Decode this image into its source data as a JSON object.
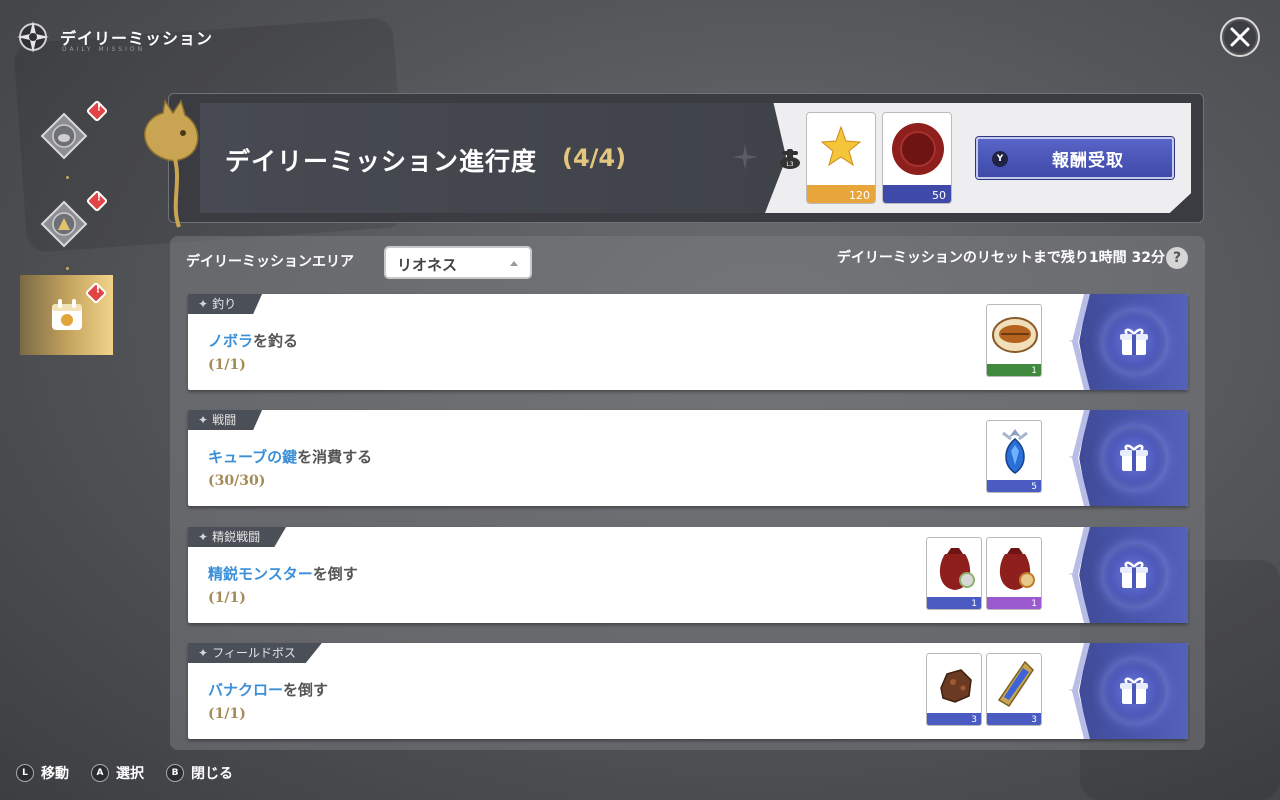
{
  "header": {
    "title": "デイリーミッション",
    "subtitle": "DAILY MISSION"
  },
  "sidebar": {
    "items": [
      {
        "icon": "boar-medal-icon",
        "badge": "!"
      },
      {
        "icon": "compass-medal-icon",
        "badge": "!"
      },
      {
        "icon": "calendar-gift-icon",
        "badge": "!",
        "active": true
      }
    ]
  },
  "banner": {
    "title": "デイリーミッション進行度",
    "count": "(4/4)",
    "rewards": [
      {
        "icon": "star-moon-crystal-icon",
        "count": "120",
        "color": "#e8a53a"
      },
      {
        "icon": "wax-seal-icon",
        "count": "50",
        "color": "#3f4aa8"
      }
    ],
    "claim_key": "Y",
    "claim_label": "報酬受取"
  },
  "area": {
    "label": "デイリーミッションエリア",
    "selected": "リオネス",
    "reset_text": "デイリーミッションのリセットまで残り1時間 32分",
    "help": "?"
  },
  "missions": [
    {
      "category": "釣り",
      "highlight": "ノボラ",
      "suffix": "を釣る",
      "progress": "(1/1)",
      "items": [
        {
          "icon": "grilled-fish-icon",
          "count": "1",
          "color": "#3f8a3c"
        }
      ]
    },
    {
      "category": "戦闘",
      "highlight": "キューブの鍵",
      "suffix": "を消費する",
      "progress": "(30/30)",
      "items": [
        {
          "icon": "blue-crystal-key-icon",
          "count": "5",
          "color": "#4a5bc2"
        }
      ]
    },
    {
      "category": "精鋭戦闘",
      "highlight": "精鋭モンスター",
      "suffix": "を倒す",
      "progress": "(1/1)",
      "items": [
        {
          "icon": "red-pouch-icon",
          "count": "1",
          "color": "#4a5bc2"
        },
        {
          "icon": "red-pouch-icon",
          "count": "1",
          "color": "#9b59d0"
        }
      ]
    },
    {
      "category": "フィールドボス",
      "highlight": "バナクロー",
      "suffix": "を倒す",
      "progress": "(1/1)",
      "items": [
        {
          "icon": "ore-chunk-icon",
          "count": "3",
          "color": "#4a5bc2"
        },
        {
          "icon": "blue-gem-shard-icon",
          "count": "3",
          "color": "#4a5bc2"
        }
      ]
    }
  ],
  "footer": [
    {
      "key": "L",
      "label": "移動"
    },
    {
      "key": "A",
      "label": "選択"
    },
    {
      "key": "B",
      "label": "閉じる"
    }
  ]
}
